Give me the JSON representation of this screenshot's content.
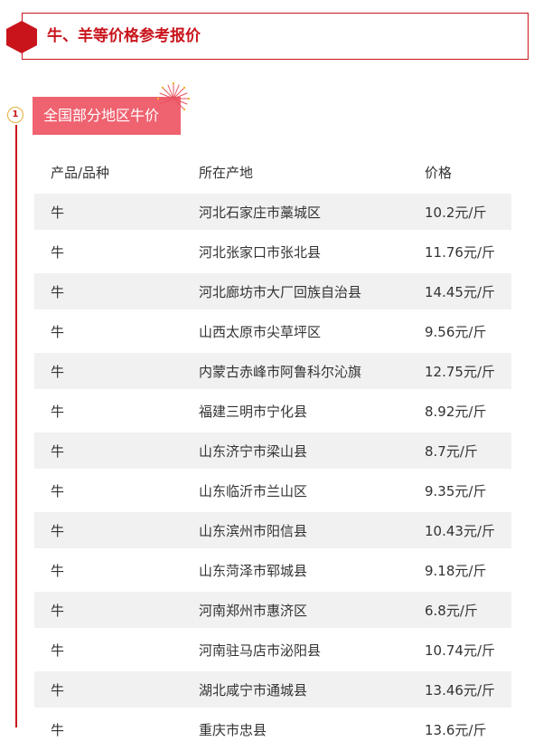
{
  "header": {
    "title": "牛、羊等价格参考报价",
    "accent_color": "#c9141c",
    "icon": "hexagon-icon"
  },
  "section": {
    "index": "1",
    "title": "全国部分地区牛价",
    "tag_color": "#ef6270",
    "decoration": "firework-icon"
  },
  "table": {
    "columns": [
      "产品/品种",
      "所在产地",
      "价格"
    ],
    "rows": [
      {
        "product": "牛",
        "origin": "河北石家庄市藁城区",
        "price": "10.2元/斤"
      },
      {
        "product": "牛",
        "origin": "河北张家口市张北县",
        "price": "11.76元/斤"
      },
      {
        "product": "牛",
        "origin": "河北廊坊市大厂回族自治县",
        "price": "14.45元/斤"
      },
      {
        "product": "牛",
        "origin": "山西太原市尖草坪区",
        "price": "9.56元/斤"
      },
      {
        "product": "牛",
        "origin": "内蒙古赤峰市阿鲁科尔沁旗",
        "price": "12.75元/斤"
      },
      {
        "product": "牛",
        "origin": "福建三明市宁化县",
        "price": "8.92元/斤"
      },
      {
        "product": "牛",
        "origin": "山东济宁市梁山县",
        "price": "8.7元/斤"
      },
      {
        "product": "牛",
        "origin": "山东临沂市兰山区",
        "price": "9.35元/斤"
      },
      {
        "product": "牛",
        "origin": "山东滨州市阳信县",
        "price": "10.43元/斤"
      },
      {
        "product": "牛",
        "origin": "山东菏泽市郓城县",
        "price": "9.18元/斤"
      },
      {
        "product": "牛",
        "origin": "河南郑州市惠济区",
        "price": "6.8元/斤"
      },
      {
        "product": "牛",
        "origin": "河南驻马店市泌阳县",
        "price": "10.74元/斤"
      },
      {
        "product": "牛",
        "origin": "湖北咸宁市通城县",
        "price": "13.46元/斤"
      },
      {
        "product": "牛",
        "origin": "重庆市忠县",
        "price": "13.6元/斤"
      }
    ]
  }
}
